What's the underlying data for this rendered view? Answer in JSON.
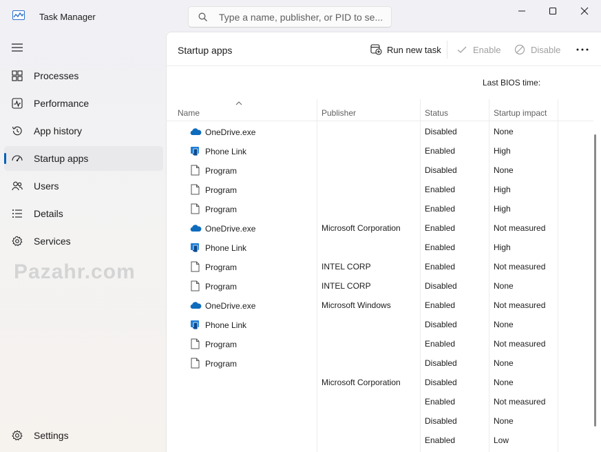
{
  "window": {
    "title": "Task Manager",
    "search_placeholder": "Type a name, publisher, or PID to se...",
    "search_value": ""
  },
  "sidebar": {
    "items": [
      {
        "label": "Processes",
        "icon": "processes-icon"
      },
      {
        "label": "Performance",
        "icon": "performance-icon"
      },
      {
        "label": "App history",
        "icon": "app-history-icon"
      },
      {
        "label": "Startup apps",
        "icon": "startup-apps-icon",
        "active": true
      },
      {
        "label": "Users",
        "icon": "users-icon"
      },
      {
        "label": "Details",
        "icon": "details-icon"
      },
      {
        "label": "Services",
        "icon": "services-icon"
      }
    ],
    "settings_label": "Settings"
  },
  "watermark": "Pazahr.com",
  "main": {
    "title": "Startup apps",
    "toolbar": {
      "run_new_task": "Run new task",
      "enable": "Enable",
      "disable": "Disable"
    },
    "bios_label": "Last BIOS time:",
    "columns": [
      "Name",
      "Publisher",
      "Status",
      "Startup impact"
    ],
    "rows": [
      {
        "name": "OneDrive.exe",
        "icon": "onedrive-icon",
        "publisher": "",
        "status": "Disabled",
        "impact": "None"
      },
      {
        "name": "Phone Link",
        "icon": "phone-link-icon",
        "publisher": "",
        "status": "Enabled",
        "impact": "High"
      },
      {
        "name": "Program",
        "icon": "program-icon",
        "publisher": "",
        "status": "Disabled",
        "impact": "None"
      },
      {
        "name": "Program",
        "icon": "program-icon",
        "publisher": "",
        "status": "Enabled",
        "impact": "High"
      },
      {
        "name": "Program",
        "icon": "program-icon",
        "publisher": "",
        "status": "Enabled",
        "impact": "High"
      },
      {
        "name": "OneDrive.exe",
        "icon": "onedrive-icon",
        "publisher": "Microsoft Corporation",
        "status": "Enabled",
        "impact": "Not measured"
      },
      {
        "name": "Phone Link",
        "icon": "phone-link-icon",
        "publisher": "",
        "status": "Enabled",
        "impact": "High"
      },
      {
        "name": "Program",
        "icon": "program-icon",
        "publisher": "INTEL CORP",
        "status": "Enabled",
        "impact": "Not measured"
      },
      {
        "name": "Program",
        "icon": "program-icon",
        "publisher": "INTEL CORP",
        "status": "Disabled",
        "impact": "None"
      },
      {
        "name": "OneDrive.exe",
        "icon": "onedrive-icon",
        "publisher": "Microsoft Windows",
        "status": "Enabled",
        "impact": "Not measured"
      },
      {
        "name": "Phone Link",
        "icon": "phone-link-icon",
        "publisher": "",
        "status": "Disabled",
        "impact": "None"
      },
      {
        "name": "Program",
        "icon": "program-icon",
        "publisher": "",
        "status": "Enabled",
        "impact": "Not measured"
      },
      {
        "name": "Program",
        "icon": "program-icon",
        "publisher": "",
        "status": "Disabled",
        "impact": "None"
      },
      {
        "name": "",
        "icon": "",
        "publisher": "Microsoft Corporation",
        "status": "Disabled",
        "impact": "None"
      },
      {
        "name": "",
        "icon": "",
        "publisher": "",
        "status": "Enabled",
        "impact": "Not measured"
      },
      {
        "name": "",
        "icon": "",
        "publisher": "",
        "status": "Disabled",
        "impact": "None"
      },
      {
        "name": "",
        "icon": "",
        "publisher": "",
        "status": "Enabled",
        "impact": "Low"
      }
    ]
  },
  "colors": {
    "accent": "#005fb8",
    "onedrive": "#0f6cbd",
    "phone_link": "#1e7fd6"
  }
}
